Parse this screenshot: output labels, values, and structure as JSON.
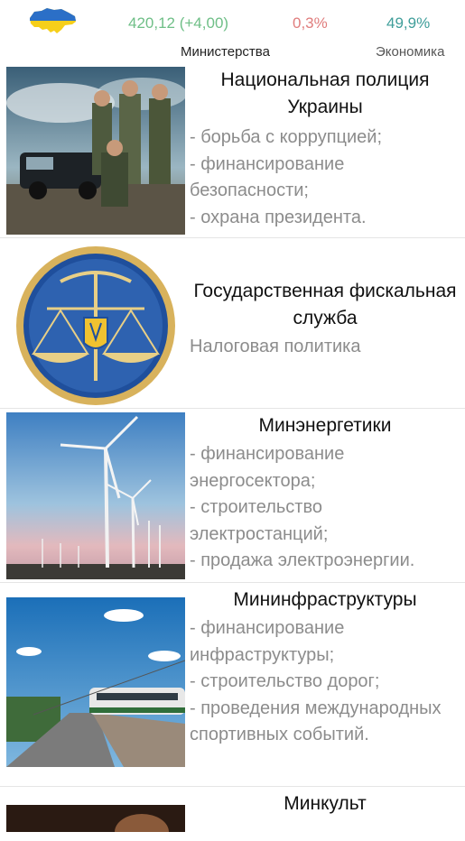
{
  "header": {
    "flag_icon": "ukraine-map-flag-icon",
    "budget": "420,12 (+4,00)",
    "rate": "0,3%",
    "approval": "49,9%",
    "tabs": [
      {
        "label": "Министерства",
        "active": true
      },
      {
        "label": "Экономика",
        "active": false
      }
    ]
  },
  "colors": {
    "budget": "#6fbf87",
    "rate": "#e07d7d",
    "approval": "#3f9e9a"
  },
  "ministries": [
    {
      "title": "Национальная полиция Украины",
      "duties": "- борьба с коррупцией;\n- финансирование безопасности;\n- охрана президента.",
      "image": "police-officers-photo"
    },
    {
      "title": "Государственная фискальная служба",
      "duties": "Налоговая политика",
      "image": "fiscal-service-emblem"
    },
    {
      "title": "Минэнергетики",
      "duties": "- финансирование энергосектора;\n- строительство электростанций;\n- продажа электроэнергии.",
      "image": "wind-turbines-photo"
    },
    {
      "title": "Mининфраструктуры",
      "duties": "- финансирование инфраструктуры;\n- строительство дорог;\n- проведения международных спортивных событий.",
      "image": "highway-train-photo"
    },
    {
      "title": "Минкульт",
      "duties": "",
      "image": "culture-photo"
    }
  ]
}
